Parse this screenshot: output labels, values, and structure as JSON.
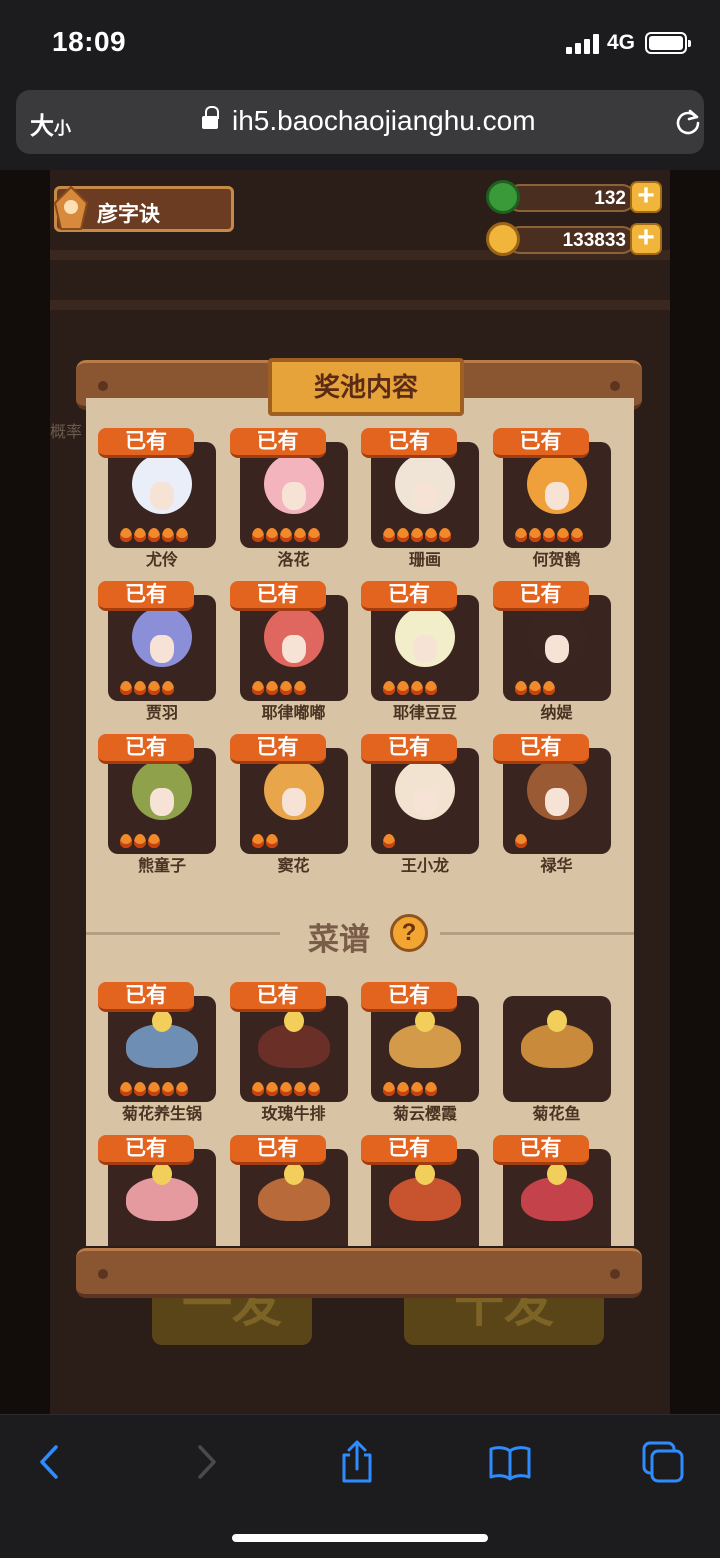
{
  "status_bar": {
    "time": "18:09",
    "network": "4G"
  },
  "browser": {
    "text_size_label_big": "大",
    "text_size_label_small": "小",
    "url": "ih5.baochaojianghu.com"
  },
  "game": {
    "player_name": "彦字诀",
    "jade": "132",
    "coins": "133833",
    "background_hint": "概率",
    "background_buttons": [
      "一发",
      "十发"
    ],
    "modal": {
      "title": "奖池内容",
      "owned_label": "已有",
      "characters": [
        {
          "name": "尤伶",
          "owned": true,
          "stars": 5,
          "color": "#e9eef8"
        },
        {
          "name": "洛花",
          "owned": true,
          "stars": 5,
          "color": "#f4b4bd"
        },
        {
          "name": "珊画",
          "owned": true,
          "stars": 5,
          "color": "#efe4d6"
        },
        {
          "name": "何贺鹤",
          "owned": true,
          "stars": 5,
          "color": "#f0a03a"
        },
        {
          "name": "贾羽",
          "owned": true,
          "stars": 4,
          "color": "#8a8fd8"
        },
        {
          "name": "耶律嘟嘟",
          "owned": true,
          "stars": 4,
          "color": "#e0675f"
        },
        {
          "name": "耶律豆豆",
          "owned": true,
          "stars": 4,
          "color": "#f2eec9"
        },
        {
          "name": "纳媞",
          "owned": true,
          "stars": 3,
          "color": "#3b2520"
        },
        {
          "name": "熊童子",
          "owned": true,
          "stars": 3,
          "color": "#8fa14b"
        },
        {
          "name": "窦花",
          "owned": true,
          "stars": 2,
          "color": "#e8a54a"
        },
        {
          "name": "王小龙",
          "owned": true,
          "stars": 1,
          "color": "#f1e3cf"
        },
        {
          "name": "禄华",
          "owned": true,
          "stars": 1,
          "color": "#9a5a33"
        }
      ],
      "recipe_section": {
        "title": "菜谱",
        "help_symbol": "?"
      },
      "recipes": [
        {
          "name": "菊花养生锅",
          "owned": true,
          "stars": 5,
          "color": "#6e8fb3"
        },
        {
          "name": "玫瑰牛排",
          "owned": true,
          "stars": 5,
          "color": "#6a2f27"
        },
        {
          "name": "菊云樱霞",
          "owned": true,
          "stars": 4,
          "color": "#d39a4a"
        },
        {
          "name": "菊花鱼",
          "owned": false,
          "stars": 0,
          "color": "#c98a3b"
        },
        {
          "name": "",
          "owned": true,
          "stars": 0,
          "color": "#e59aa0"
        },
        {
          "name": "",
          "owned": true,
          "stars": 0,
          "color": "#b86a3a"
        },
        {
          "name": "",
          "owned": true,
          "stars": 0,
          "color": "#c8532f"
        },
        {
          "name": "",
          "owned": true,
          "stars": 0,
          "color": "#c4434a"
        }
      ]
    }
  },
  "toolbar": {
    "icons": [
      "back-icon",
      "forward-icon",
      "share-icon",
      "bookmarks-icon",
      "tabs-icon"
    ]
  }
}
